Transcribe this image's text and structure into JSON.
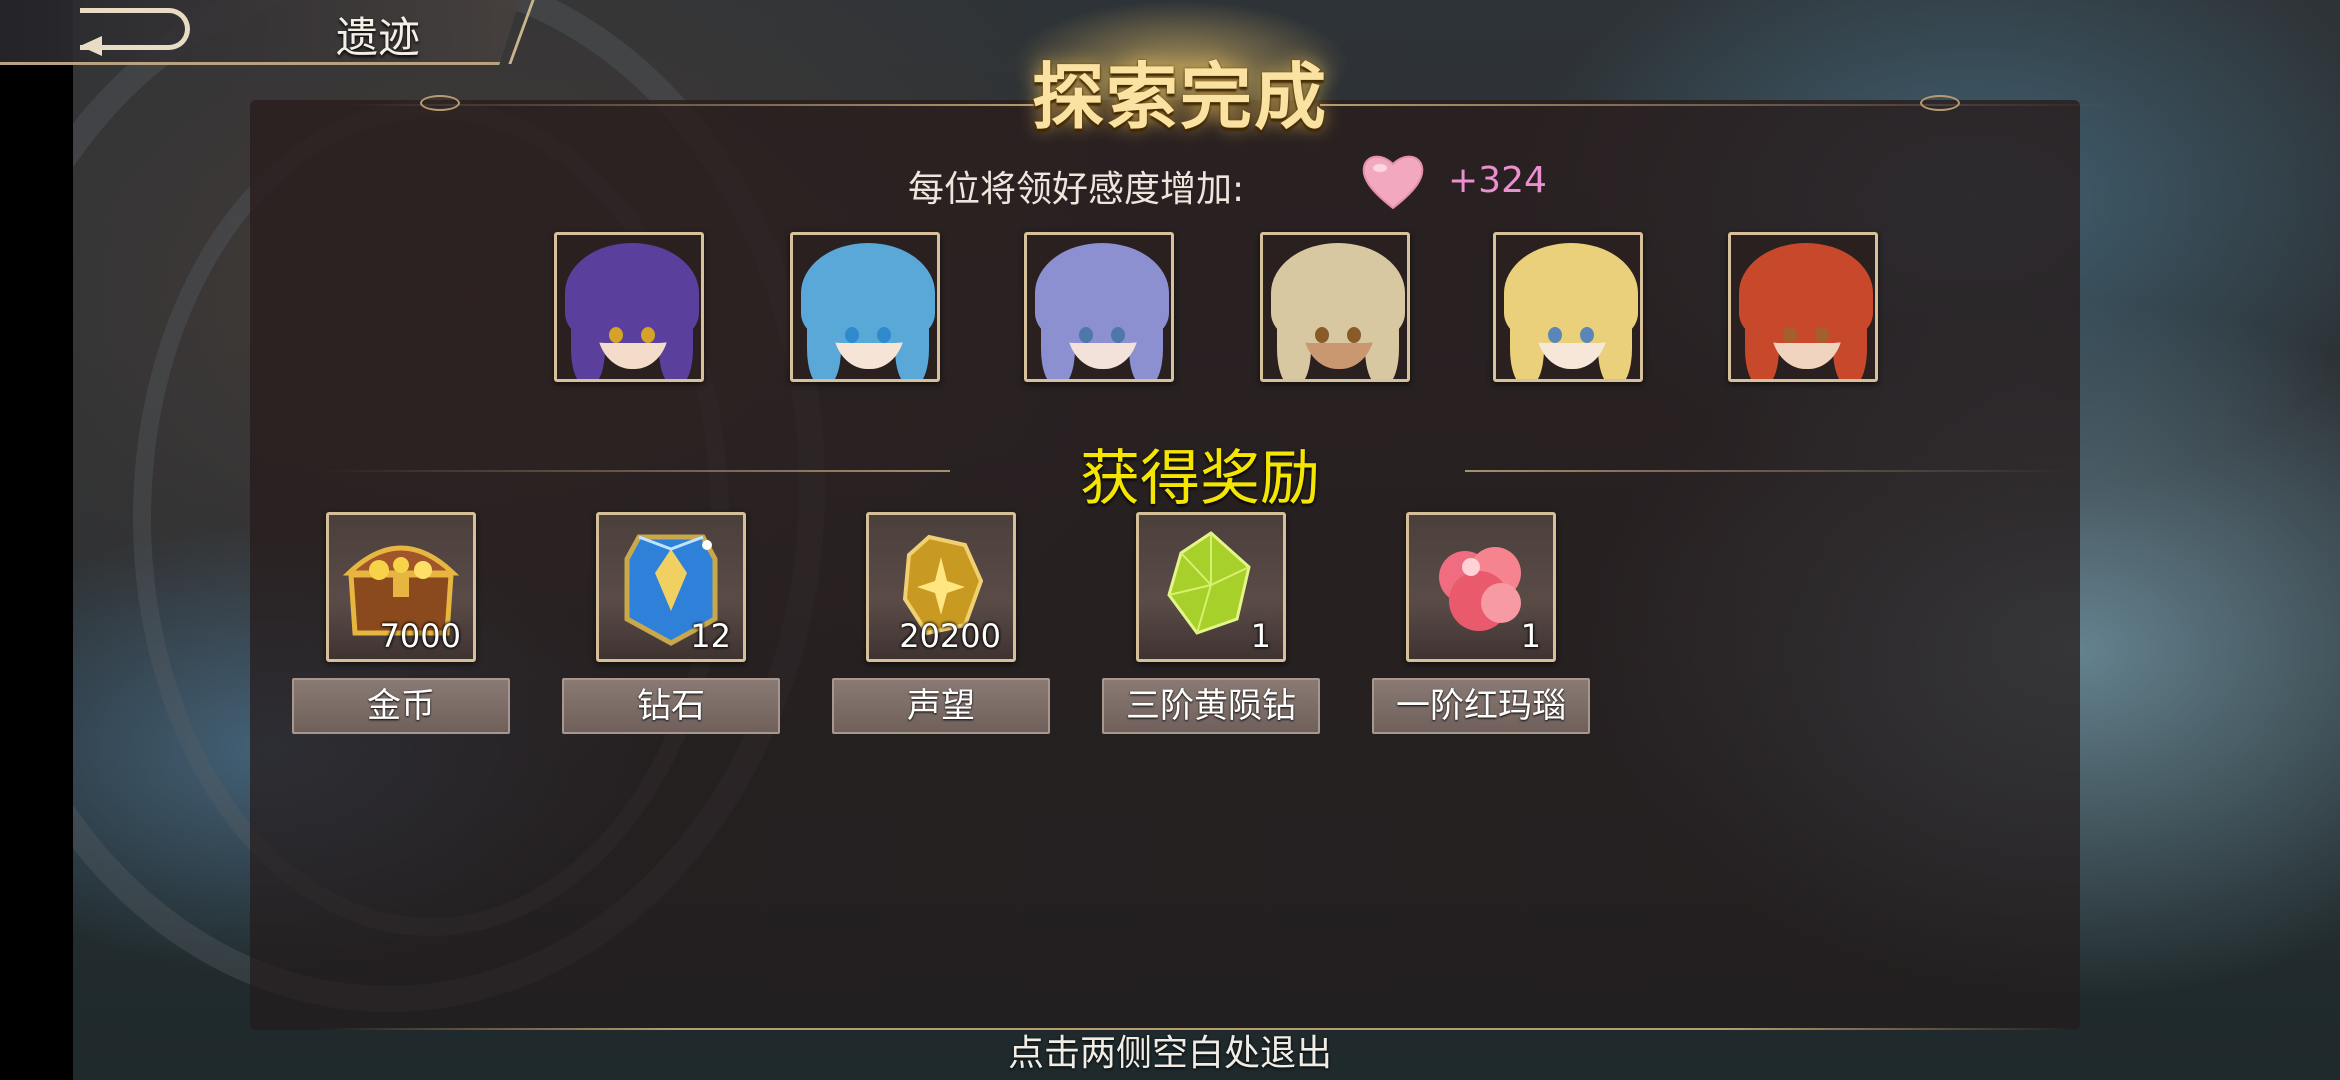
{
  "top_bar": {
    "title": "遗迹"
  },
  "header": {
    "title": "探索完成"
  },
  "affection": {
    "label": "每位将领好感度增加:",
    "value": "+324"
  },
  "portraits": [
    {
      "hair": "#5b3f9c",
      "skin": "#f4dccb",
      "eye": "#d5a326"
    },
    {
      "hair": "#59a8d8",
      "skin": "#f6e4d6",
      "eye": "#2f8ccc"
    },
    {
      "hair": "#8c8fd0",
      "skin": "#f2e2d9",
      "eye": "#4d78a8"
    },
    {
      "hair": "#d8c8a2",
      "skin": "#c99870",
      "eye": "#8a5a28"
    },
    {
      "hair": "#ead07a",
      "skin": "#f7e7d8",
      "eye": "#5a86b8"
    },
    {
      "hair": "#c8482c",
      "skin": "#f1d4c0",
      "eye": "#a4602a"
    }
  ],
  "rewards_title": "获得奖励",
  "rewards": [
    {
      "name": "金币",
      "count": "7000",
      "icon": "treasure-chest-icon"
    },
    {
      "name": "钻石",
      "count": "12",
      "icon": "diamond-crystal-icon"
    },
    {
      "name": "声望",
      "count": "20200",
      "icon": "prestige-badge-icon"
    },
    {
      "name": "三阶黄陨钻",
      "count": "1",
      "icon": "yellow-meteor-gem-icon"
    },
    {
      "name": "一阶红玛瑙",
      "count": "1",
      "icon": "red-agate-icon"
    }
  ],
  "footer": {
    "hint": "点击两侧空白处退出"
  },
  "colors": {
    "panel": "#2a1f1f",
    "gold_border": "#d4bf98",
    "title_gold": "#f9e2a2",
    "rewards_title": "#f4e600",
    "affection_value": "#ea8fd0",
    "heart": "#f2a8bf"
  }
}
